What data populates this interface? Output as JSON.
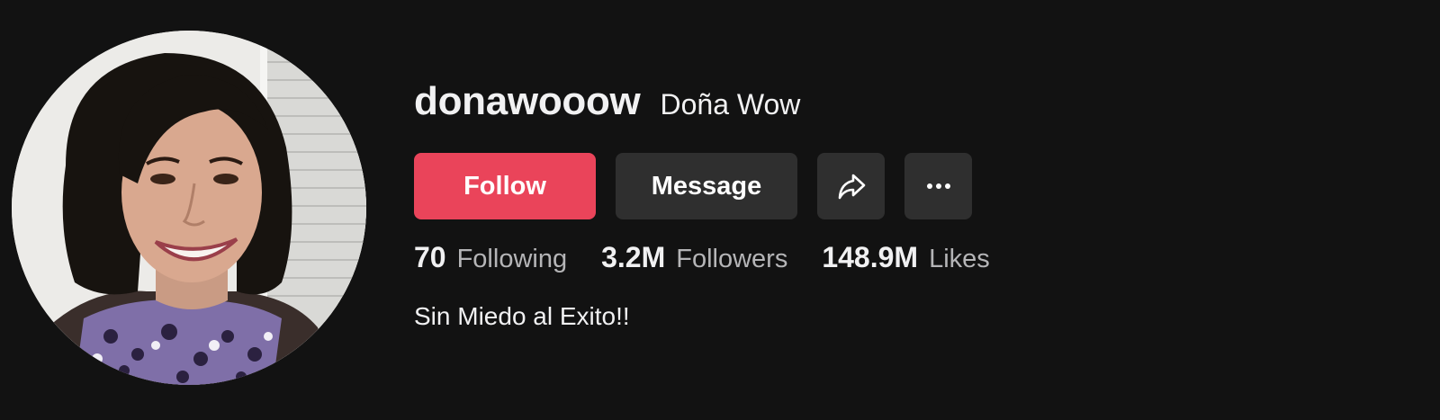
{
  "profile": {
    "username": "donawooow",
    "nickname": "Doña Wow",
    "bio": "Sin Miedo al Exito!!",
    "avatar_alt": "avatar"
  },
  "actions": {
    "follow_label": "Follow",
    "message_label": "Message",
    "share_icon": "share-arrow-icon",
    "more_icon": "more-dots-icon"
  },
  "stats": {
    "following_count": "70",
    "following_label": "Following",
    "followers_count": "3.2M",
    "followers_label": "Followers",
    "likes_count": "148.9M",
    "likes_label": "Likes"
  },
  "colors": {
    "background": "#121212",
    "follow_button": "#ea445a",
    "secondary_button": "#2f2f2f",
    "text_primary": "#f1f1f2",
    "text_secondary": "#b5b5b7"
  }
}
